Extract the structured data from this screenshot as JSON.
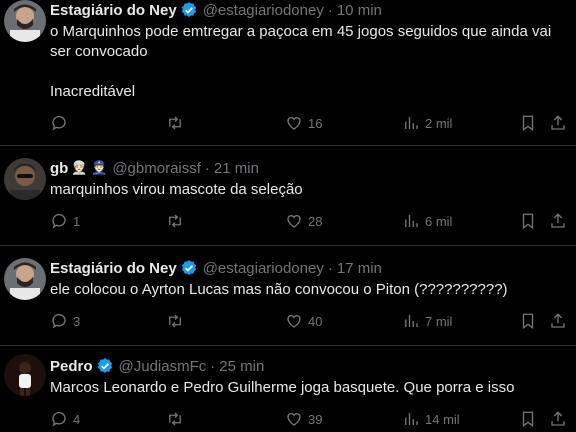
{
  "tweets": [
    {
      "name": "Estagiário do Ney",
      "handle": "@estagiariodoney",
      "separator": "·",
      "time": "10 min",
      "lines": [
        "o Marquinhos pode emtregar a paçoca em 45 jogos seguidos que ainda vai",
        "ser convocado",
        "",
        "Inacreditável"
      ],
      "replies": "",
      "likes": "16",
      "views": "2 mil",
      "verified": true
    },
    {
      "name": "gb",
      "emojis": "👳🏻 👮🏻",
      "handle": "@gbmoraissf",
      "separator": "·",
      "time": "21 min",
      "lines": [
        "marquinhos virou mascote da seleção"
      ],
      "replies": "1",
      "likes": "28",
      "views": "6 mil",
      "verified": false
    },
    {
      "name": "Estagiário do Ney",
      "handle": "@estagiariodoney",
      "separator": "·",
      "time": "17 min",
      "lines": [
        "ele colocou o Ayrton Lucas mas não convocou o Piton (??????????)"
      ],
      "replies": "3",
      "likes": "40",
      "views": "7 mil",
      "verified": true
    },
    {
      "name": "Pedro",
      "handle": "@JudiasmFc",
      "separator": "·",
      "time": "25 min",
      "lines": [
        "Marcos Leonardo e Pedro Guilherme joga basquete. Que porra e isso"
      ],
      "replies": "4",
      "likes": "39",
      "views": "14 mil",
      "verified": true
    }
  ],
  "colors": {
    "background": "#000000",
    "text": "#e7e9ea",
    "muted": "#71767b",
    "verified": "#1d9bf0",
    "divider": "#2f3336"
  },
  "icons": [
    "reply-icon",
    "retweet-icon",
    "like-icon",
    "views-icon",
    "bookmark-icon",
    "share-icon",
    "verified-badge-icon"
  ]
}
